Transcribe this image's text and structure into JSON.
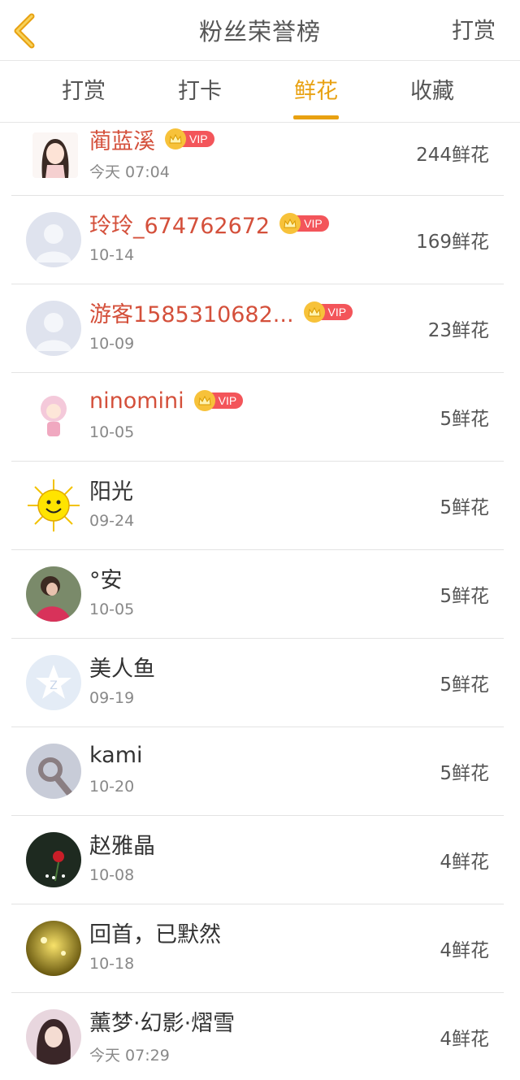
{
  "header": {
    "title": "粉丝荣誉榜",
    "action_label": "打赏"
  },
  "tabs": [
    {
      "label": "打赏",
      "active": false
    },
    {
      "label": "打卡",
      "active": false
    },
    {
      "label": "鲜花",
      "active": true
    },
    {
      "label": "收藏",
      "active": false
    }
  ],
  "vip_label": "VIP",
  "colors": {
    "accent": "#e8a111",
    "vip_name": "#d4503b",
    "vip_tag": "#f3555a"
  },
  "rows": [
    {
      "name": "蔺蓝溪",
      "vip": true,
      "date": "今天 07:04",
      "amount": "244鲜花",
      "avatar": "girl-cartoon-avatar"
    },
    {
      "name": "玲玲_674762672",
      "vip": true,
      "date": "10-14",
      "amount": "169鲜花",
      "avatar": "default-avatar"
    },
    {
      "name": "游客1585310682...",
      "vip": true,
      "date": "10-09",
      "amount": "23鲜花",
      "avatar": "default-avatar"
    },
    {
      "name": "ninomini",
      "vip": true,
      "date": "10-05",
      "amount": "5鲜花",
      "avatar": "pink-doll-avatar"
    },
    {
      "name": "阳光",
      "vip": false,
      "date": "09-24",
      "amount": "5鲜花",
      "avatar": "sun-avatar"
    },
    {
      "name": "°安",
      "vip": false,
      "date": "10-05",
      "amount": "5鲜花",
      "avatar": "photo-avatar"
    },
    {
      "name": "美人鱼",
      "vip": false,
      "date": "09-19",
      "amount": "5鲜花",
      "avatar": "qzone-star-avatar"
    },
    {
      "name": "kami",
      "vip": false,
      "date": "10-20",
      "amount": "5鲜花",
      "avatar": "hand-photo-avatar"
    },
    {
      "name": "赵雅晶",
      "vip": false,
      "date": "10-08",
      "amount": "4鲜花",
      "avatar": "rose-photo-avatar"
    },
    {
      "name": "回首，已默然",
      "vip": false,
      "date": "10-18",
      "amount": "4鲜花",
      "avatar": "golden-photo-avatar"
    },
    {
      "name": "薰梦·幻影·熠雪",
      "vip": false,
      "date": "今天 07:29",
      "amount": "4鲜花",
      "avatar": "girl-photo-avatar"
    }
  ]
}
